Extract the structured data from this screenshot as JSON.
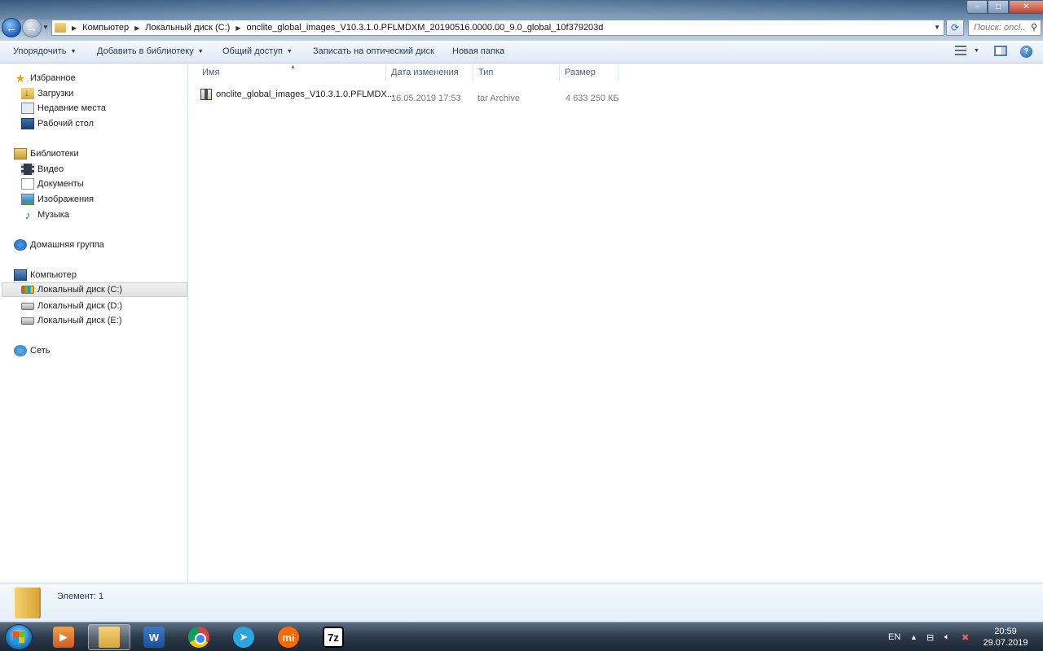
{
  "window": {
    "controls": {
      "minimize": "–",
      "maximize": "□",
      "close": "✕"
    }
  },
  "address": {
    "crumbs": [
      "Компьютер",
      "Локальный диск (C:)",
      "onclite_global_images_V10.3.1.0.PFLMDXM_20190516.0000.00_9.0_global_10f379203d"
    ],
    "search_placeholder": "Поиск: oncl..."
  },
  "toolbar": {
    "organize": "Упорядочить",
    "add_to_library": "Добавить в библиотеку",
    "share": "Общий доступ",
    "burn": "Записать на оптический диск",
    "new_folder": "Новая папка"
  },
  "nav": {
    "favorites": "Избранное",
    "downloads": "Загрузки",
    "recent": "Недавние места",
    "desktop": "Рабочий стол",
    "libraries": "Библиотеки",
    "video": "Видео",
    "documents": "Документы",
    "pictures": "Изображения",
    "music": "Музыка",
    "homegroup": "Домашняя группа",
    "computer": "Компьютер",
    "disk_c": "Локальный диск (C:)",
    "disk_d": "Локальный диск (D:)",
    "disk_e": "Локальный диск (E:)",
    "network": "Сеть"
  },
  "columns": {
    "name": "Имя",
    "modified": "Дата изменения",
    "type": "Тип",
    "size": "Размер"
  },
  "files": [
    {
      "name": "onclite_global_images_V10.3.1.0.PFLMDX...",
      "modified": "16.05.2019 17:53",
      "type": "tar Archive",
      "size": "4 633 250 КБ"
    }
  ],
  "status": {
    "items": "Элемент: 1"
  },
  "taskbar": {
    "word_glyph": "W",
    "telegram_glyph": "➤",
    "mi_glyph": "mi",
    "sevenzip_glyph": "7z"
  },
  "tray": {
    "lang": "EN",
    "time": "20:59",
    "date": "29.07.2019"
  }
}
